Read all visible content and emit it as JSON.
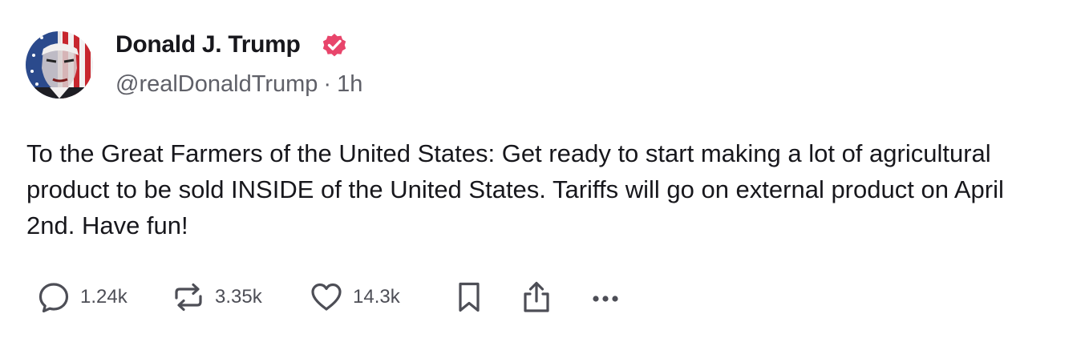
{
  "author": {
    "name": "Donald J. Trump",
    "handle": "@realDonaldTrump",
    "separator": "·",
    "time": "1h",
    "avatar_icon": "avatar-flag-portrait",
    "verified_icon": "verified-badge-icon"
  },
  "post": {
    "text": "To the Great Farmers of the United States: Get ready to start making a lot of agricultural product to be sold INSIDE of the United States. Tariffs will go on external product on April 2nd. Have fun!"
  },
  "actions": {
    "replies": "1.24k",
    "reposts": "3.35k",
    "likes": "14.3k"
  },
  "colors": {
    "text": "#17171c",
    "muted": "#5f6068",
    "verified": "#e8456b",
    "icon": "#4d4e56"
  }
}
